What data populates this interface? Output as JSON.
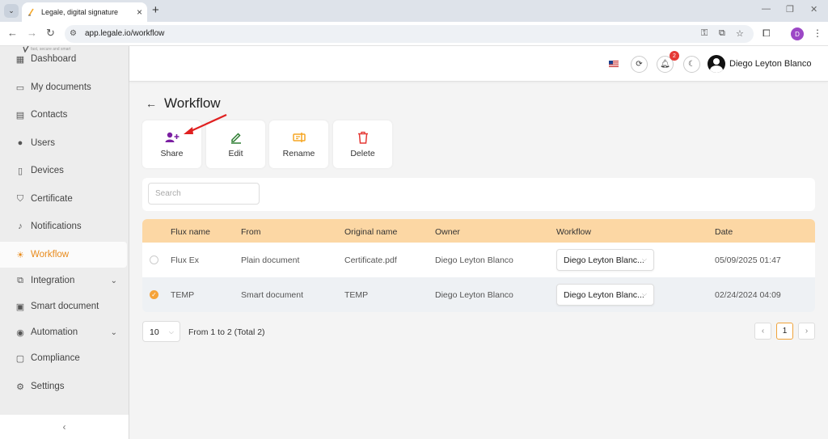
{
  "browser": {
    "tab_title": "Legale, digital signature",
    "url": "app.legale.io/workflow",
    "profile_initial": "D"
  },
  "sidebar": {
    "logo_tagline": "fast, secure and smart",
    "items": [
      {
        "label": "Dashboard",
        "icon": "dashboard-icon"
      },
      {
        "label": "My documents",
        "icon": "folder-icon"
      },
      {
        "label": "Contacts",
        "icon": "contacts-icon"
      },
      {
        "label": "Users",
        "icon": "user-icon"
      },
      {
        "label": "Devices",
        "icon": "tablet-icon"
      },
      {
        "label": "Certificate",
        "icon": "shield-icon"
      },
      {
        "label": "Notifications",
        "icon": "bell-icon"
      },
      {
        "label": "Workflow",
        "icon": "workflow-icon",
        "active": true
      },
      {
        "label": "Integration",
        "icon": "external-link-icon",
        "expandable": true
      },
      {
        "label": "Smart document",
        "icon": "smart-document-icon"
      },
      {
        "label": "Automation",
        "icon": "automation-icon",
        "expandable": true
      },
      {
        "label": "Compliance",
        "icon": "chat-icon"
      },
      {
        "label": "Settings",
        "icon": "gear-icon"
      }
    ],
    "collapse_icon": "chevron-left-icon"
  },
  "header": {
    "notification_count": "2",
    "user_name": "Diego Leyton Blanco"
  },
  "page": {
    "title": "Workflow"
  },
  "actions": [
    {
      "label": "Share",
      "icon": "add-user-icon",
      "color": "#7b1fa2"
    },
    {
      "label": "Edit",
      "icon": "pencil-icon",
      "color": "#2e7d32"
    },
    {
      "label": "Rename",
      "icon": "rename-icon",
      "color": "#f5a623"
    },
    {
      "label": "Delete",
      "icon": "trash-icon",
      "color": "#e53935"
    }
  ],
  "search": {
    "placeholder": "Search"
  },
  "table": {
    "columns": [
      "Flux name",
      "From",
      "Original name",
      "Owner",
      "Workflow",
      "Date"
    ],
    "rows": [
      {
        "checked": false,
        "flux_name": "Flux Ex",
        "from": "Plain document",
        "original_name": "Certificate.pdf",
        "owner": "Diego Leyton Blanco",
        "workflow": "Diego Leyton Blanc...",
        "date": "05/09/2025 01:47"
      },
      {
        "checked": true,
        "flux_name": "TEMP",
        "from": "Smart document",
        "original_name": "TEMP",
        "owner": "Diego Leyton Blanco",
        "workflow": "Diego Leyton Blanc...",
        "date": "02/24/2024 04:09"
      }
    ]
  },
  "pagination": {
    "page_size": "10",
    "info": "From 1 to 2 (Total 2)",
    "current_page": "1"
  },
  "colors": {
    "accent": "#e88a1a",
    "table_header": "#fcd7a4",
    "annotation": "#e02020"
  }
}
